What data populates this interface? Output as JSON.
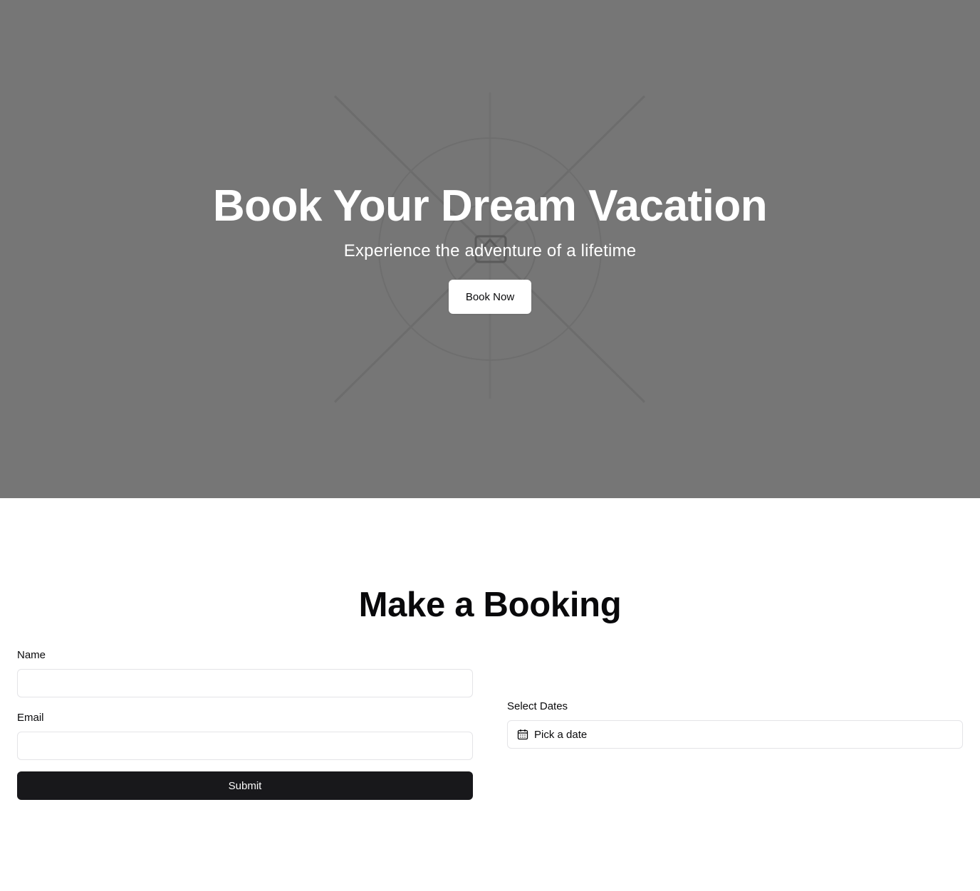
{
  "hero": {
    "title": "Book Your Dream Vacation",
    "subtitle": "Experience the adventure of a lifetime",
    "cta_label": "Book Now",
    "background_color": "#767676",
    "image_icon": "image-placeholder-icon"
  },
  "booking": {
    "title": "Make a Booking",
    "name_label": "Name",
    "name_value": "",
    "email_label": "Email",
    "email_value": "",
    "submit_label": "Submit",
    "dates_label": "Select Dates",
    "dates_placeholder": "Pick a date",
    "dates_icon": "calendar-icon"
  },
  "colors": {
    "primary_button": "#18181b",
    "input_border": "#e4e4e7",
    "text": "#09090b"
  }
}
